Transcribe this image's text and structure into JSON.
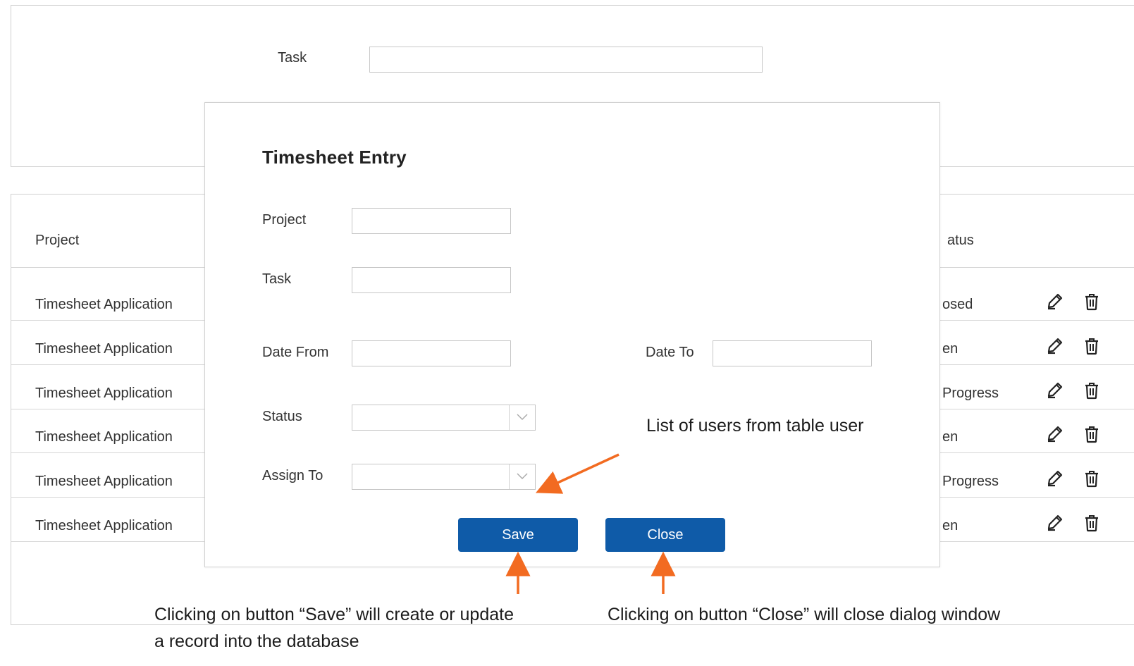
{
  "filter": {
    "task_label": "Task",
    "task_value": ""
  },
  "table": {
    "header_project": "Project",
    "header_status": "atus",
    "rows": [
      {
        "project": "Timesheet Application",
        "status": "osed"
      },
      {
        "project": "Timesheet Application",
        "status": "en"
      },
      {
        "project": "Timesheet Application",
        "status": "Progress"
      },
      {
        "project": "Timesheet Application",
        "status": "en"
      },
      {
        "project": "Timesheet Application",
        "status": "Progress"
      },
      {
        "project": "Timesheet Application",
        "status": "en"
      }
    ],
    "row_icons": [
      "edit-icon",
      "trash-icon"
    ]
  },
  "dialog": {
    "title": "Timesheet  Entry",
    "project_label": "Project",
    "task_label": "Task",
    "date_from_label": "Date From",
    "date_to_label": "Date To",
    "status_label": "Status",
    "assign_to_label": "Assign To",
    "project_value": "",
    "task_value": "",
    "date_from_value": "",
    "date_to_value": "",
    "status_value": "",
    "assign_to_value": "",
    "save_label": "Save",
    "close_label": "Close"
  },
  "annotations": {
    "assign_note": "List of users from table user",
    "save_note": "Clicking on button “Save” will create or update a record into the database",
    "close_note": "Clicking on button “Close” will close dialog window"
  },
  "colors": {
    "button_bg": "#0f5ba8",
    "arrow": "#f26b21",
    "border": "#d0d0d0"
  }
}
